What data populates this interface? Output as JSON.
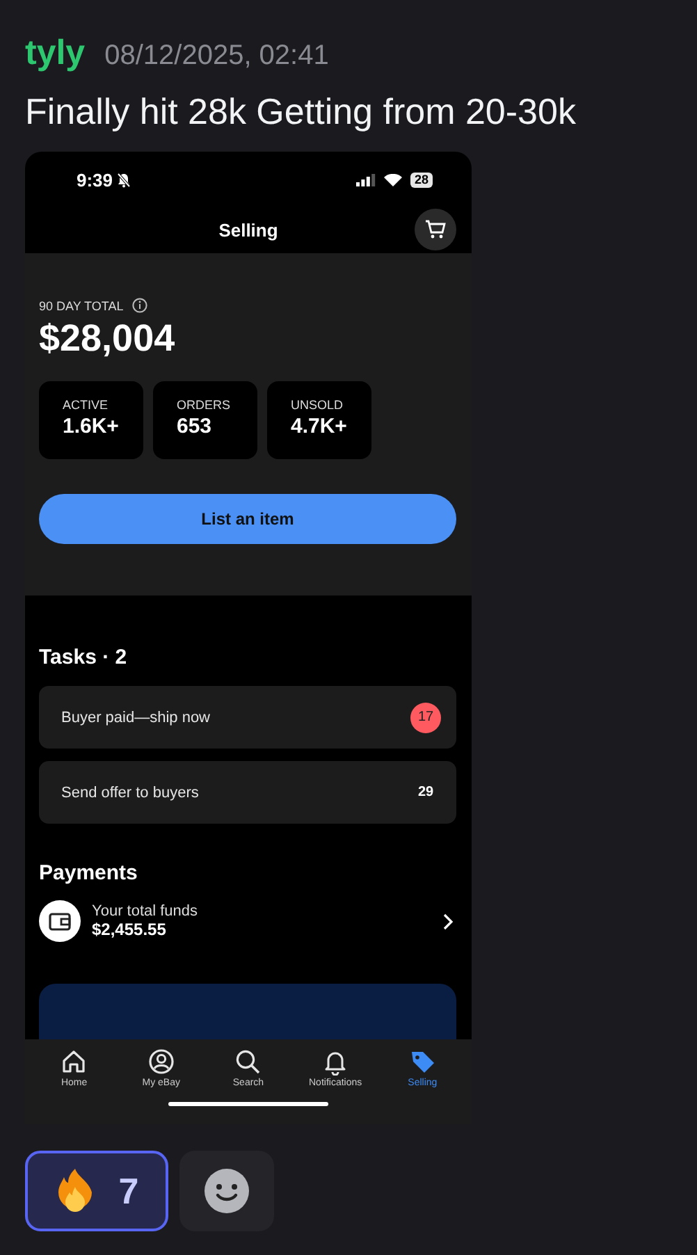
{
  "message": {
    "author": "tyly",
    "timestamp": "08/12/2025, 02:41",
    "text": "Finally hit 28k Getting from 20-30k"
  },
  "screenshot": {
    "status_bar": {
      "time": "9:39",
      "battery": "28"
    },
    "header": {
      "title": "Selling"
    },
    "summary": {
      "label": "90 DAY TOTAL",
      "amount": "$28,004",
      "stats": [
        {
          "label": "ACTIVE",
          "value": "1.6K+"
        },
        {
          "label": "ORDERS",
          "value": "653"
        },
        {
          "label": "UNSOLD",
          "value": "4.7K+"
        }
      ]
    },
    "list_button": "List an item",
    "tasks": {
      "title": "Tasks · 2",
      "items": [
        {
          "label": "Buyer paid—ship now",
          "count": "17",
          "urgent": true
        },
        {
          "label": "Send offer to buyers",
          "count": "29",
          "urgent": false
        }
      ]
    },
    "payments": {
      "title": "Payments",
      "funds_label": "Your total funds",
      "funds_amount": "$2,455.55"
    },
    "tab_bar": [
      {
        "label": "Home",
        "selected": false
      },
      {
        "label": "My eBay",
        "selected": false
      },
      {
        "label": "Search",
        "selected": false
      },
      {
        "label": "Notifications",
        "selected": false
      },
      {
        "label": "Selling",
        "selected": true
      }
    ]
  },
  "reactions": [
    {
      "count": "7",
      "selected": true
    }
  ]
}
